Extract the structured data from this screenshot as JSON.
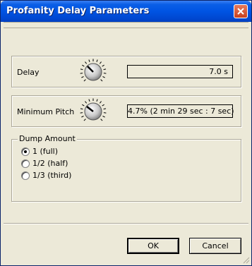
{
  "window": {
    "title": "Profanity Delay Parameters",
    "close_icon": "close-icon"
  },
  "delay": {
    "label": "Delay",
    "value": "7.0 s",
    "knob_level": 0.35
  },
  "minimum_pitch": {
    "label": "Minimum Pitch",
    "value": "4.7% (2 min 29 sec : 7 sec)",
    "knob_level": 0.3
  },
  "dump_amount": {
    "legend": "Dump Amount",
    "options": [
      {
        "label": "1 (full)",
        "checked": true
      },
      {
        "label": "1/2 (half)",
        "checked": false
      },
      {
        "label": "1/3 (third)",
        "checked": false
      }
    ]
  },
  "buttons": {
    "ok": "OK",
    "cancel": "Cancel"
  }
}
